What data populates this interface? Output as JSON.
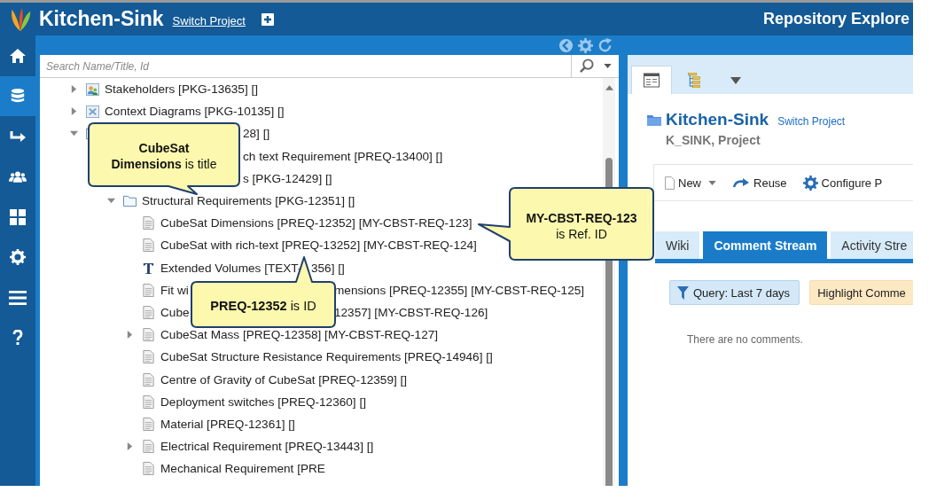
{
  "header": {
    "app_title": "Kitchen-Sink",
    "switch_link": "Switch Project",
    "page_title": "Repository Explore"
  },
  "nav": [
    {
      "kind": "home",
      "selected": false
    },
    {
      "kind": "database",
      "selected": true
    },
    {
      "kind": "link",
      "selected": false
    },
    {
      "kind": "users",
      "selected": false
    },
    {
      "kind": "grid",
      "selected": false
    },
    {
      "kind": "settings",
      "selected": false
    },
    {
      "kind": "menu",
      "selected": false
    },
    {
      "kind": "help",
      "selected": false
    }
  ],
  "search": {
    "placeholder": "Search Name/Title, Id"
  },
  "tree": [
    {
      "label": "Stakeholders [PKG-13635] []",
      "kind": "stakeholders",
      "expanded": false
    },
    {
      "label": "Context Diagrams [PKG-10135] []",
      "kind": "diagrams",
      "expanded": false
    },
    {
      "label": "28] []",
      "kind": "folder",
      "expanded": true,
      "children": [
        {
          "label": "ch text Requirement [PREQ-13400] []"
        },
        {
          "label": "s [PKG-12429] []",
          "children": [
            {
              "label": "Structural Requirements [PKG-12351] []",
              "kind": "folder",
              "expanded": true,
              "children": [
                {
                  "label": "CubeSat Dimensions [PREQ-12352] [MY-CBST-REQ-123]",
                  "kind": "document"
                },
                {
                  "label": "CubeSat with rich-text [PREQ-13252] [MY-CBST-REQ-124]",
                  "kind": "document"
                },
                {
                  "lead": "Extended Volumes [TEXT-",
                  "label": "356] []",
                  "kind": "text"
                },
                {
                  "lead": "Fit wi",
                  "label": "mensions [PREQ-12355] [MY-CBST-REQ-125]",
                  "kind": "document"
                },
                {
                  "lead": "Cube",
                  "label": "12357] [MY-CBST-REQ-126]",
                  "kind": "document"
                },
                {
                  "label": "CubeSat Mass [PREQ-12358] [MY-CBST-REQ-127]",
                  "kind": "document",
                  "expanded": false
                },
                {
                  "label": "CubeSat Structure Resistance Requirements [PREQ-14946] []",
                  "kind": "document"
                },
                {
                  "label": "Centre of Gravity of CubeSat [PREQ-12359] []",
                  "kind": "document"
                },
                {
                  "label": "Deployment switches [PREQ-12360] []",
                  "kind": "document"
                },
                {
                  "label": "Material [PREQ-12361] []",
                  "kind": "document"
                },
                {
                  "label": "Electrical Requirement [PREQ-13443] []",
                  "kind": "document",
                  "expanded": false
                },
                {
                  "label": "Mechanical Requirement [PRE",
                  "kind": "document"
                }
              ]
            }
          ]
        }
      ]
    }
  ],
  "detail_tabs": [
    {
      "kind": "properties",
      "selected": true
    },
    {
      "kind": "tree",
      "selected": false
    },
    {
      "kind": "more",
      "selected": false
    }
  ],
  "project": {
    "name": "Kitchen-Sink",
    "link": "Switch Project",
    "subtitle": "K_SINK, Project"
  },
  "toolbar": [
    {
      "kind": "new",
      "label": "New"
    },
    {
      "kind": "reuse",
      "label": "Reuse"
    },
    {
      "kind": "configure",
      "label": "Configure P"
    }
  ],
  "stream_tabs": [
    {
      "label": "Wiki",
      "selected": false
    },
    {
      "label": "Comment Stream",
      "selected": true
    },
    {
      "label": "Activity Stre",
      "selected": false
    }
  ],
  "filters": [
    {
      "kind": "query",
      "label": "Query: Last 7 days"
    },
    {
      "kind": "highlight",
      "label": "Highlight Comme"
    }
  ],
  "empty_message": "There are no comments.",
  "callouts": [
    {
      "text": "**CubeSat Dimensions** is title"
    },
    {
      "text": "**PREQ-12352** is ID"
    },
    {
      "text": "**MY-CBST-REQ-123** is Ref. ID"
    }
  ]
}
